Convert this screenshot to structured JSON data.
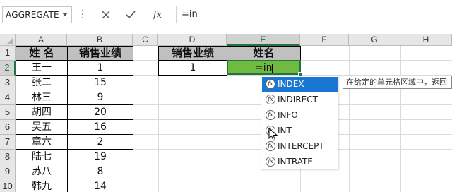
{
  "formula_bar": {
    "name_box": "AGGREGATE",
    "icons": [
      "cancel-icon",
      "enter-icon",
      "insert-function-icon"
    ],
    "fx_label": "fx",
    "formula": "=in"
  },
  "columns": [
    "A",
    "B",
    "C",
    "D",
    "E",
    "F",
    "G",
    "H"
  ],
  "selected_column": "E",
  "rows": [
    "1",
    "2",
    "3",
    "4",
    "5",
    "6",
    "7",
    "8",
    "9",
    "10"
  ],
  "selected_row": "2",
  "table1": {
    "headers": [
      "姓 名",
      "销售业绩"
    ],
    "rows": [
      [
        "王一",
        "1"
      ],
      [
        "张二",
        "15"
      ],
      [
        "林三",
        "9"
      ],
      [
        "胡四",
        "20"
      ],
      [
        "吴五",
        "16"
      ],
      [
        "章六",
        "2"
      ],
      [
        "陆七",
        "19"
      ],
      [
        "苏八",
        "8"
      ],
      [
        "韩九",
        "14"
      ]
    ]
  },
  "table2": {
    "headers": [
      "销售业绩",
      "姓名"
    ],
    "row": [
      "1",
      "=in"
    ]
  },
  "autocomplete": {
    "items": [
      "INDEX",
      "INDIRECT",
      "INFO",
      "INT",
      "INTERCEPT",
      "INTRATE"
    ],
    "highlighted": 0,
    "tooltip": "在给定的单元格区域中，返回"
  },
  "colors": {
    "active_fill": "#6fba3f",
    "selection_green": "#217346",
    "highlight_blue": "#1976d2",
    "header_grey": "#c0c0c0"
  }
}
